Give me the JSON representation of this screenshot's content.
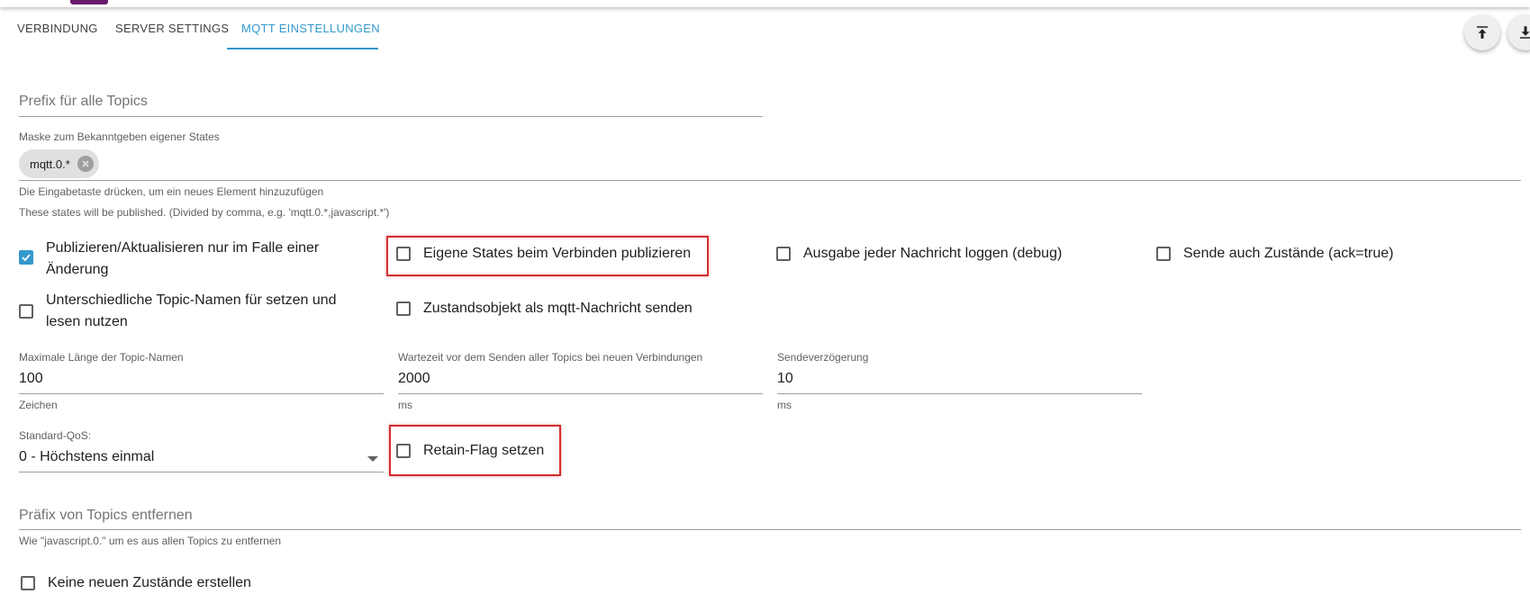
{
  "tabs": [
    {
      "label": "VERBINDUNG"
    },
    {
      "label": "SERVER SETTINGS"
    },
    {
      "label": "MQTT EINSTELLUNGEN"
    }
  ],
  "fabs": {
    "upload_icon": "upload-icon",
    "download_icon": "download-icon"
  },
  "prefix": {
    "label": "Prefix für alle Topics",
    "value": ""
  },
  "mask": {
    "label": "Maske zum Bekanntgeben eigener States",
    "chips": [
      "mqtt.0.*"
    ],
    "helper1": "Die Eingabetaste drücken, um ein neues Element hinzuzufügen",
    "helper2": "These states will be published. (Divided by comma, e.g. 'mqtt.0.*,javascript.*')"
  },
  "checkboxes": {
    "publish_on_change": {
      "label_line1": "Publizieren/Aktualisieren nur im Falle einer",
      "label_line2": "Änderung",
      "checked": true
    },
    "publish_own_states": {
      "label": "Eigene States beim Verbinden publizieren",
      "checked": false
    },
    "log_debug": {
      "label": "Ausgabe jeder Nachricht loggen (debug)",
      "checked": false
    },
    "send_ack_true": {
      "label": "Sende auch Zustände (ack=true)",
      "checked": false
    },
    "different_topic_names": {
      "label_line1": "Unterschiedliche Topic-Namen für setzen und",
      "label_line2": "lesen nutzen",
      "checked": false
    },
    "state_object_as_message": {
      "label": "Zustandsobjekt als mqtt-Nachricht senden",
      "checked": false
    },
    "retain_flag": {
      "label": "Retain-Flag setzen",
      "checked": false
    },
    "no_new_states": {
      "label": "Keine neuen Zustände erstellen",
      "checked": false
    }
  },
  "max_topic_length": {
    "label": "Maximale Länge der Topic-Namen",
    "value": "100",
    "unit": "Zeichen"
  },
  "wait_time": {
    "label": "Wartezeit vor dem Senden aller Topics bei neuen Verbindungen",
    "value": "2000",
    "unit": "ms"
  },
  "send_delay": {
    "label": "Sendeverzögerung",
    "value": "10",
    "unit": "ms"
  },
  "qos": {
    "label": "Standard-QoS:",
    "value": "0 - Höchstens einmal"
  },
  "remove_prefix": {
    "label": "Präfix von Topics entfernen",
    "value": "",
    "helper": "Wie \"javascript.0.\" um es aus allen Topics zu entfernen"
  },
  "colors": {
    "accent": "#3399cc",
    "highlight": "#d32f2f"
  }
}
